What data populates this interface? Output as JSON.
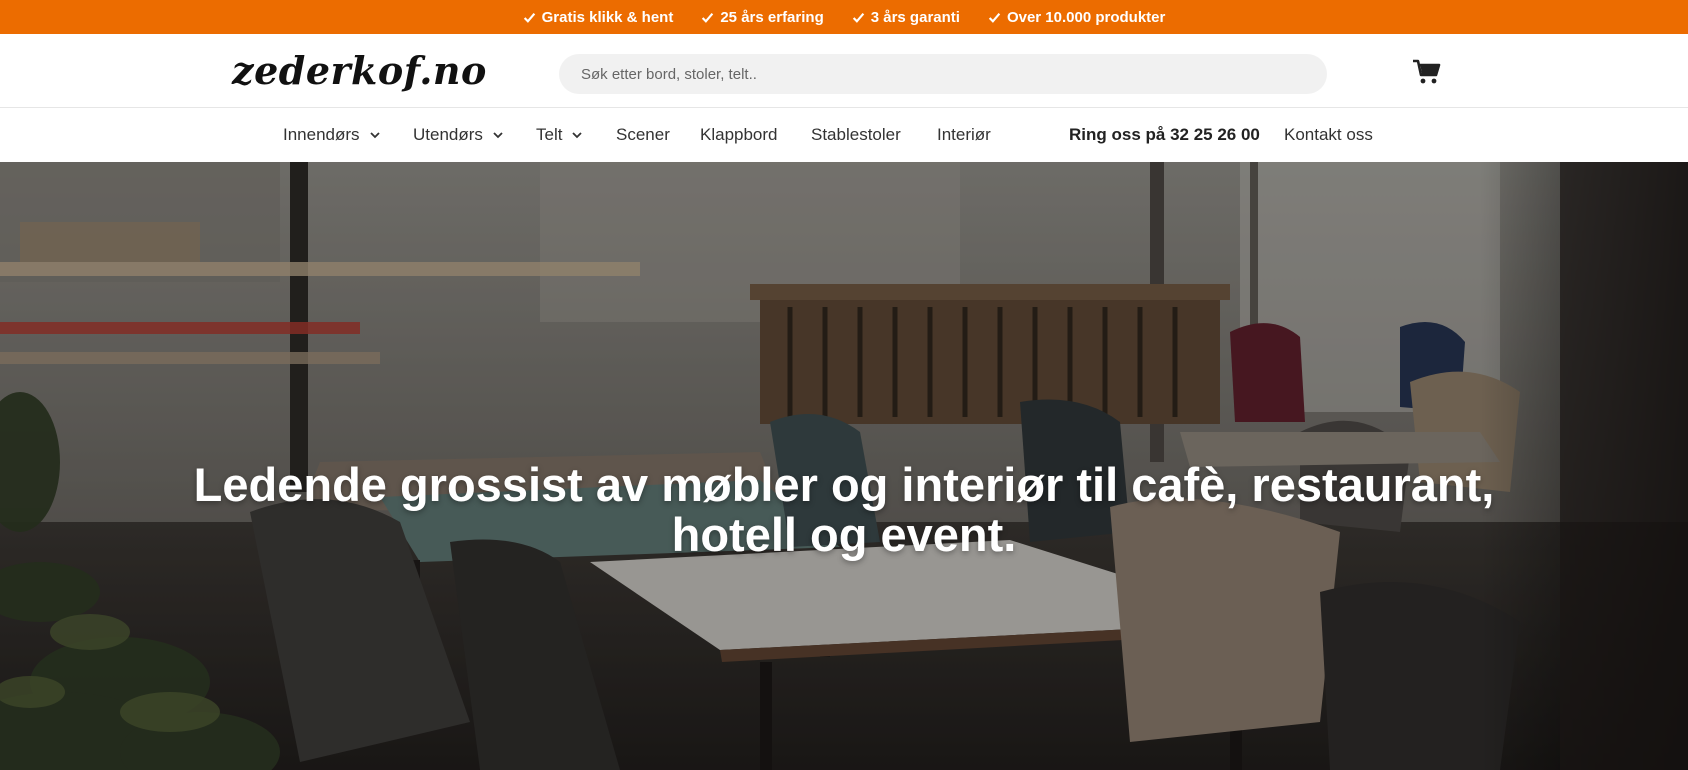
{
  "topbar": {
    "usps": [
      "Gratis klikk & hent",
      "25 års erfaring",
      "3 års garanti",
      "Over 10.000 produkter"
    ],
    "background": "#ec6c00"
  },
  "header": {
    "logo": "zederkof.no",
    "search_placeholder": "Søk etter bord, stoler, telt..",
    "cart_icon": "cart-icon"
  },
  "nav": {
    "items": [
      {
        "label": "Innendørs",
        "dropdown": true
      },
      {
        "label": "Utendørs",
        "dropdown": true
      },
      {
        "label": "Telt",
        "dropdown": true
      },
      {
        "label": "Scener",
        "dropdown": false
      },
      {
        "label": "Klappbord",
        "dropdown": false
      },
      {
        "label": "Stablestoler",
        "dropdown": false
      },
      {
        "label": "Interiør",
        "dropdown": false
      }
    ],
    "phone": "Ring oss på 32 25 26 00",
    "contact": "Kontakt oss"
  },
  "hero": {
    "title_line1": "Ledende grossist av møbler og interiør til cafè, restaurant,",
    "title_line2": "hotell og event."
  }
}
